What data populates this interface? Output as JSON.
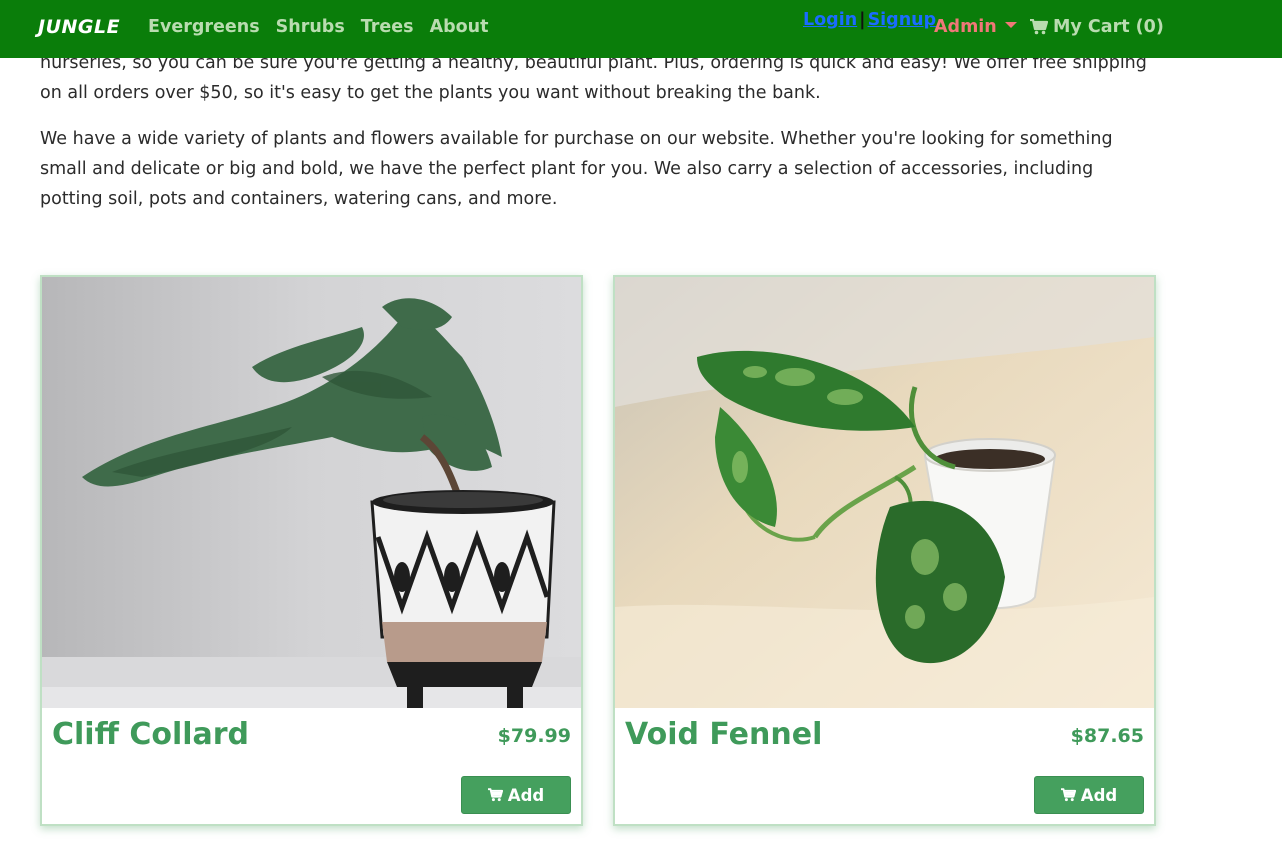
{
  "nav": {
    "brand": "JUNGLE",
    "links": [
      "Evergreens",
      "Shrubs",
      "Trees",
      "About"
    ],
    "login": "Login",
    "separator": "|",
    "signup": "Signup",
    "admin": "Admin",
    "cart": "My Cart (0)"
  },
  "intro": {
    "paragraph1": "nurseries, so you can be sure you're getting a healthy, beautiful plant. Plus, ordering is quick and easy! We offer free shipping on all orders over $50, so it's easy to get the plants you want without breaking the bank.",
    "paragraph2": "We have a wide variety of plants and flowers available for purchase on our website. Whether you're looking for something small and delicate or big and bold, we have the perfect plant for you. We also carry a selection of accessories, including potting soil, pots and containers, watering cans, and more."
  },
  "products": [
    {
      "name": "Cliff Collard",
      "price": "$79.99",
      "button": "Add"
    },
    {
      "name": "Void Fennel",
      "price": "$87.65",
      "button": "Add"
    }
  ],
  "colors": {
    "navbar": "#0a7d0a",
    "accent": "#3f9a5a",
    "button": "#45a05e",
    "admin": "#f07878",
    "link": "#1a6cff"
  },
  "icons": {
    "cart": "shopping-cart-icon",
    "admin_toggle": "caret-down-icon"
  }
}
